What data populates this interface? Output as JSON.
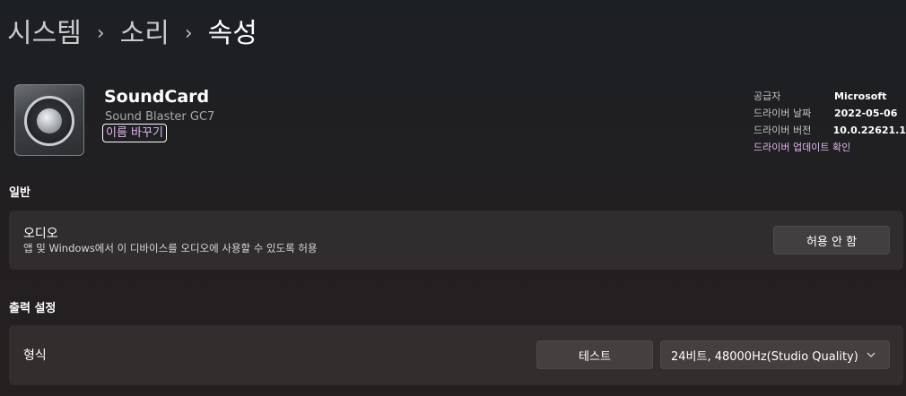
{
  "breadcrumb": {
    "items": [
      "시스템",
      "소리",
      "속성"
    ],
    "separator": "›"
  },
  "device": {
    "name": "SoundCard",
    "model": "Sound Blaster GC7",
    "rename_label": "이름 바꾸기",
    "icon": "speaker-icon"
  },
  "driver": {
    "rows": [
      {
        "label": "공급자",
        "value": "Microsoft"
      },
      {
        "label": "드라이버 날짜",
        "value": "2022-05-06"
      },
      {
        "label": "드라이버 버전",
        "value": "10.0.22621.1"
      }
    ],
    "update_link": "드라이버 업데이트 확인"
  },
  "general": {
    "heading": "일반",
    "audio": {
      "title": "오디오",
      "description": "앱 및 Windows에서 이 디바이스를 오디오에 사용할 수 있도록 허용",
      "button_label": "허용 안 함"
    }
  },
  "output": {
    "heading": "출력 설정",
    "format": {
      "title": "형식",
      "test_label": "테스트",
      "selected_format": "24비트, 48000Hz(Studio Quality)",
      "dropdown_icon": "chevron-down-icon"
    }
  },
  "colors": {
    "link": "#e0b5f0",
    "background": "#1f1f22"
  }
}
